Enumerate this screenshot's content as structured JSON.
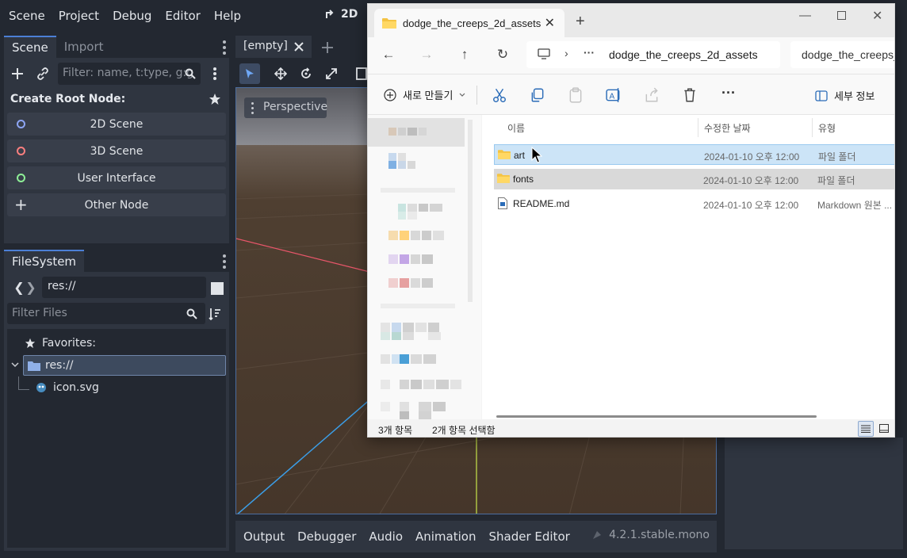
{
  "menubar": {
    "items": [
      "Scene",
      "Project",
      "Debug",
      "Editor",
      "Help"
    ],
    "mode": "2D"
  },
  "scene_dock": {
    "tabs": [
      "Scene",
      "Import"
    ],
    "filter_placeholder": "Filter: name, t:type, g:g",
    "create_root_label": "Create Root Node:",
    "root_buttons": [
      {
        "label": "2D Scene",
        "color": "#8da5f3"
      },
      {
        "label": "3D Scene",
        "color": "#fc7f7f"
      },
      {
        "label": "User Interface",
        "color": "#8eef97"
      },
      {
        "label": "Other Node"
      }
    ]
  },
  "filesystem_dock": {
    "tab": "FileSystem",
    "path": "res://",
    "filter_placeholder": "Filter Files",
    "tree": {
      "favorites": "Favorites:",
      "root": "res://",
      "file": "icon.svg"
    }
  },
  "viewport": {
    "tab": "[empty]",
    "perspective_label": "Perspective",
    "colors": {
      "x_axis": "#e8566a",
      "z_axis": "#3b9ee8",
      "y_axis": "#c8e64a",
      "ground": "#4a3b2e",
      "sky_top": "#595a60"
    }
  },
  "bottom_panel": {
    "tabs": [
      "Output",
      "Debugger",
      "Audio",
      "Animation",
      "Shader Editor"
    ],
    "version": "4.2.1.stable.mono"
  },
  "explorer": {
    "tab_title": "dodge_the_creeps_2d_assets",
    "address": "dodge_the_creeps_2d_assets",
    "search_text": "dodge_the_creeps_",
    "new_label": "새로 만들기",
    "details_label": "세부 정보",
    "columns": {
      "name": "이름",
      "modified": "수정한 날짜",
      "type": "유형"
    },
    "files": [
      {
        "name": "art",
        "modified": "2024-01-10 오후 12:00",
        "type": "파일 폴더"
      },
      {
        "name": "fonts",
        "modified": "2024-01-10 오후 12:00",
        "type": "파일 폴더"
      },
      {
        "name": "README.md",
        "modified": "2024-01-10 오후 12:00",
        "type": "Markdown 원본 ..."
      }
    ],
    "status": {
      "count": "3개 항목",
      "selected": "2개 항목 선택함"
    }
  }
}
